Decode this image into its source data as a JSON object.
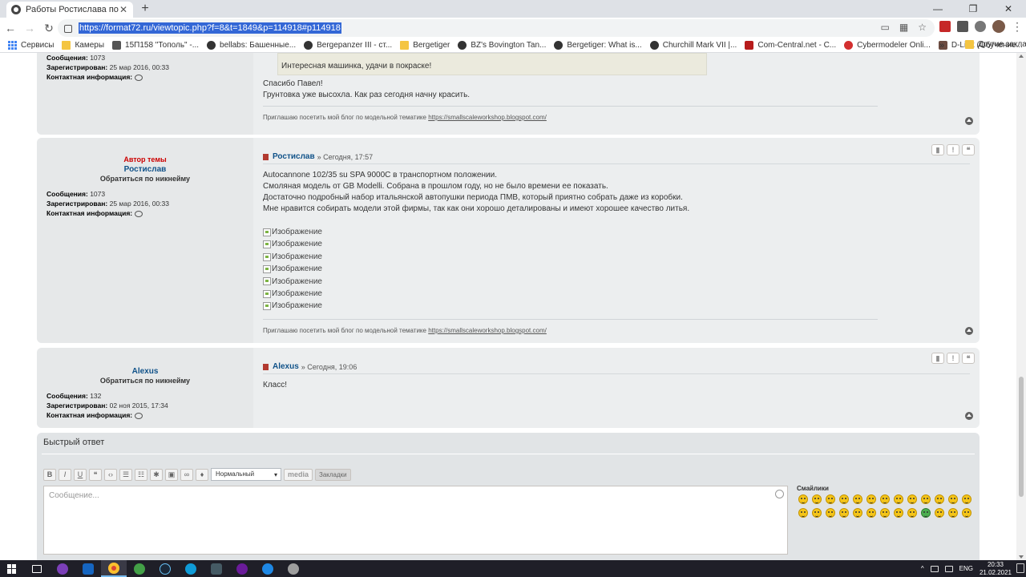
{
  "browser": {
    "tab_title": "Работы Ростислава по теме ПМВ",
    "tab_close": "✕",
    "new_tab": "+",
    "window_controls": [
      "—",
      "❐",
      "✕"
    ],
    "url": "https://format72.ru/viewtopic.php?f=8&t=1849&p=114918#p114918",
    "bookmarks": [
      {
        "label": "Сервисы",
        "icon": "apps-icon"
      },
      {
        "label": "Камеры",
        "icon": "folder-icon"
      },
      {
        "label": "15П158 \"Тополь\" -...",
        "icon": "site-icon"
      },
      {
        "label": "bellabs: Башенные...",
        "icon": "site-icon"
      },
      {
        "label": "Bergepanzer III - ст...",
        "icon": "site-icon"
      },
      {
        "label": "Bergetiger",
        "icon": "folder-icon"
      },
      {
        "label": "BZ's Bovington Tan...",
        "icon": "site-icon"
      },
      {
        "label": "Bergetiger: What is...",
        "icon": "site-icon"
      },
      {
        "label": "Churchill Mark VII |...",
        "icon": "site-icon"
      },
      {
        "label": "Com-Central.net - C...",
        "icon": "site-icon"
      },
      {
        "label": "Cybermodeler Onli...",
        "icon": "site-icon"
      },
      {
        "label": "D-Link (Обучение...",
        "icon": "site-icon"
      }
    ],
    "bookmarks_more": "»",
    "other_bookmarks": "Другие закладки"
  },
  "posts": [
    {
      "id": "prev",
      "stats": {
        "messages_label": "Сообщения:",
        "messages": "1073",
        "registered_label": "Зарегистрирован:",
        "registered": "25 мар 2016, 00:33",
        "contact_label": "Контактная информация:"
      },
      "quote_text": "Интересная машинка, удачи в покраске!",
      "lines": [
        "Спасибо Павел!",
        "Грунтовка уже высохла. Как раз сегодня начну красить."
      ],
      "sig_text": "Приглашаю посетить мой блог по модельной тематике",
      "sig_link": "https://smallscaleworkshop.blogspot.com/"
    },
    {
      "id": "rostislav",
      "author_tag": "Автор темы",
      "username": "Ростислав",
      "rank": "Обратиться по никнейму",
      "stats": {
        "messages_label": "Сообщения:",
        "messages": "1073",
        "registered_label": "Зарегистрирован:",
        "registered": "25 мар 2016, 00:33",
        "contact_label": "Контактная информация:"
      },
      "author": "Ростислав",
      "time": "» Сегодня, 17:57",
      "lines": [
        "Autocannone 102/35 su SPA 9000C в транспортном положении.",
        "Смоляная модель от GB Modelli. Собрана в прошлом году, но не было времени ее показать.",
        "Достаточно подробный набор итальянской автопушки периода ПМВ, который приятно собрать даже из коробки.",
        "Мне нравится собирать модели этой фирмы, так как они хорошо деталированы и имеют хорошее качество литья."
      ],
      "images": [
        "Изображение",
        "Изображение",
        "Изображение",
        "Изображение",
        "Изображение",
        "Изображение",
        "Изображение"
      ],
      "sig_text": "Приглашаю посетить мой блог по модельной тематике",
      "sig_link": "https://smallscaleworkshop.blogspot.com/",
      "buttons": [
        "bookmark",
        "!",
        "quote"
      ]
    },
    {
      "id": "alexus",
      "username": "Alexus",
      "rank": "Обратиться по никнейму",
      "stats": {
        "messages_label": "Сообщения:",
        "messages": "132",
        "registered_label": "Зарегистрирован:",
        "registered": "02 ноя 2015, 17:34",
        "contact_label": "Контактная информация:"
      },
      "author": "Alexus",
      "time": "» Сегодня, 19:06",
      "lines": [
        "Класс!"
      ]
    }
  ],
  "quick_reply": {
    "title": "Быстрый ответ",
    "tools": [
      "B",
      "I",
      "U",
      "❝",
      "‹›",
      "☰",
      "☷",
      "✱",
      "▣",
      "∞",
      "♦"
    ],
    "font_size_select": "Нормальный",
    "media_label": "media",
    "bookmarks_label": "Закладки",
    "placeholder": "Сообщение...",
    "smilies_title": "Смайлики",
    "smilies_count": 26
  },
  "taskbar": {
    "lang": "ENG",
    "time": "20:33",
    "date": "21.02.2021"
  },
  "colors": {
    "link": "#105289",
    "author_tag": "#cc0000",
    "post_bg": "#eceeef",
    "taskbar": "#1f1f28"
  }
}
